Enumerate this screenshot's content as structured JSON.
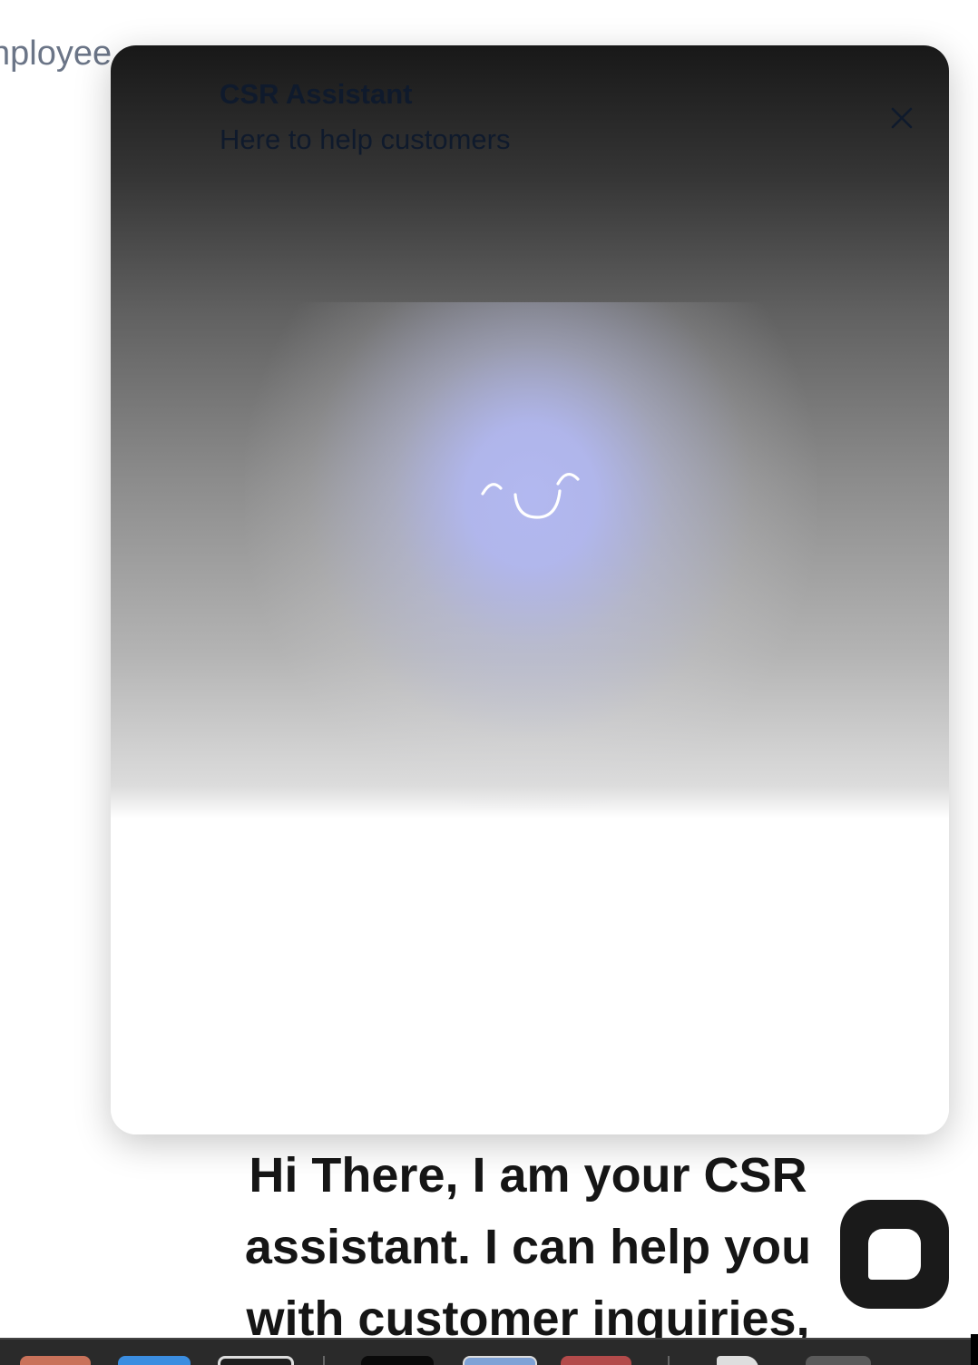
{
  "background": {
    "partial_text": "nployee"
  },
  "assistant_panel": {
    "title": "CSR Assistant",
    "subtitle": "Here to help customers",
    "close_icon": "close-icon",
    "avatar_icon": "smiley-face-icon",
    "glow_color": "#b2b8f0"
  },
  "greeting": {
    "text": "Hi There, I am your CSR assistant. I can help you with customer inquiries,"
  },
  "chat_launcher": {
    "icon": "chat-bubble-icon",
    "color": "#1a1a1a"
  },
  "dock": {
    "app_colors": [
      "#c9725a",
      "#3b8de0",
      "#1e1e1e",
      "#0a0a0a",
      "#7fa2d6",
      "#b34a4a",
      "#dedede",
      "#5a5a5a"
    ]
  }
}
